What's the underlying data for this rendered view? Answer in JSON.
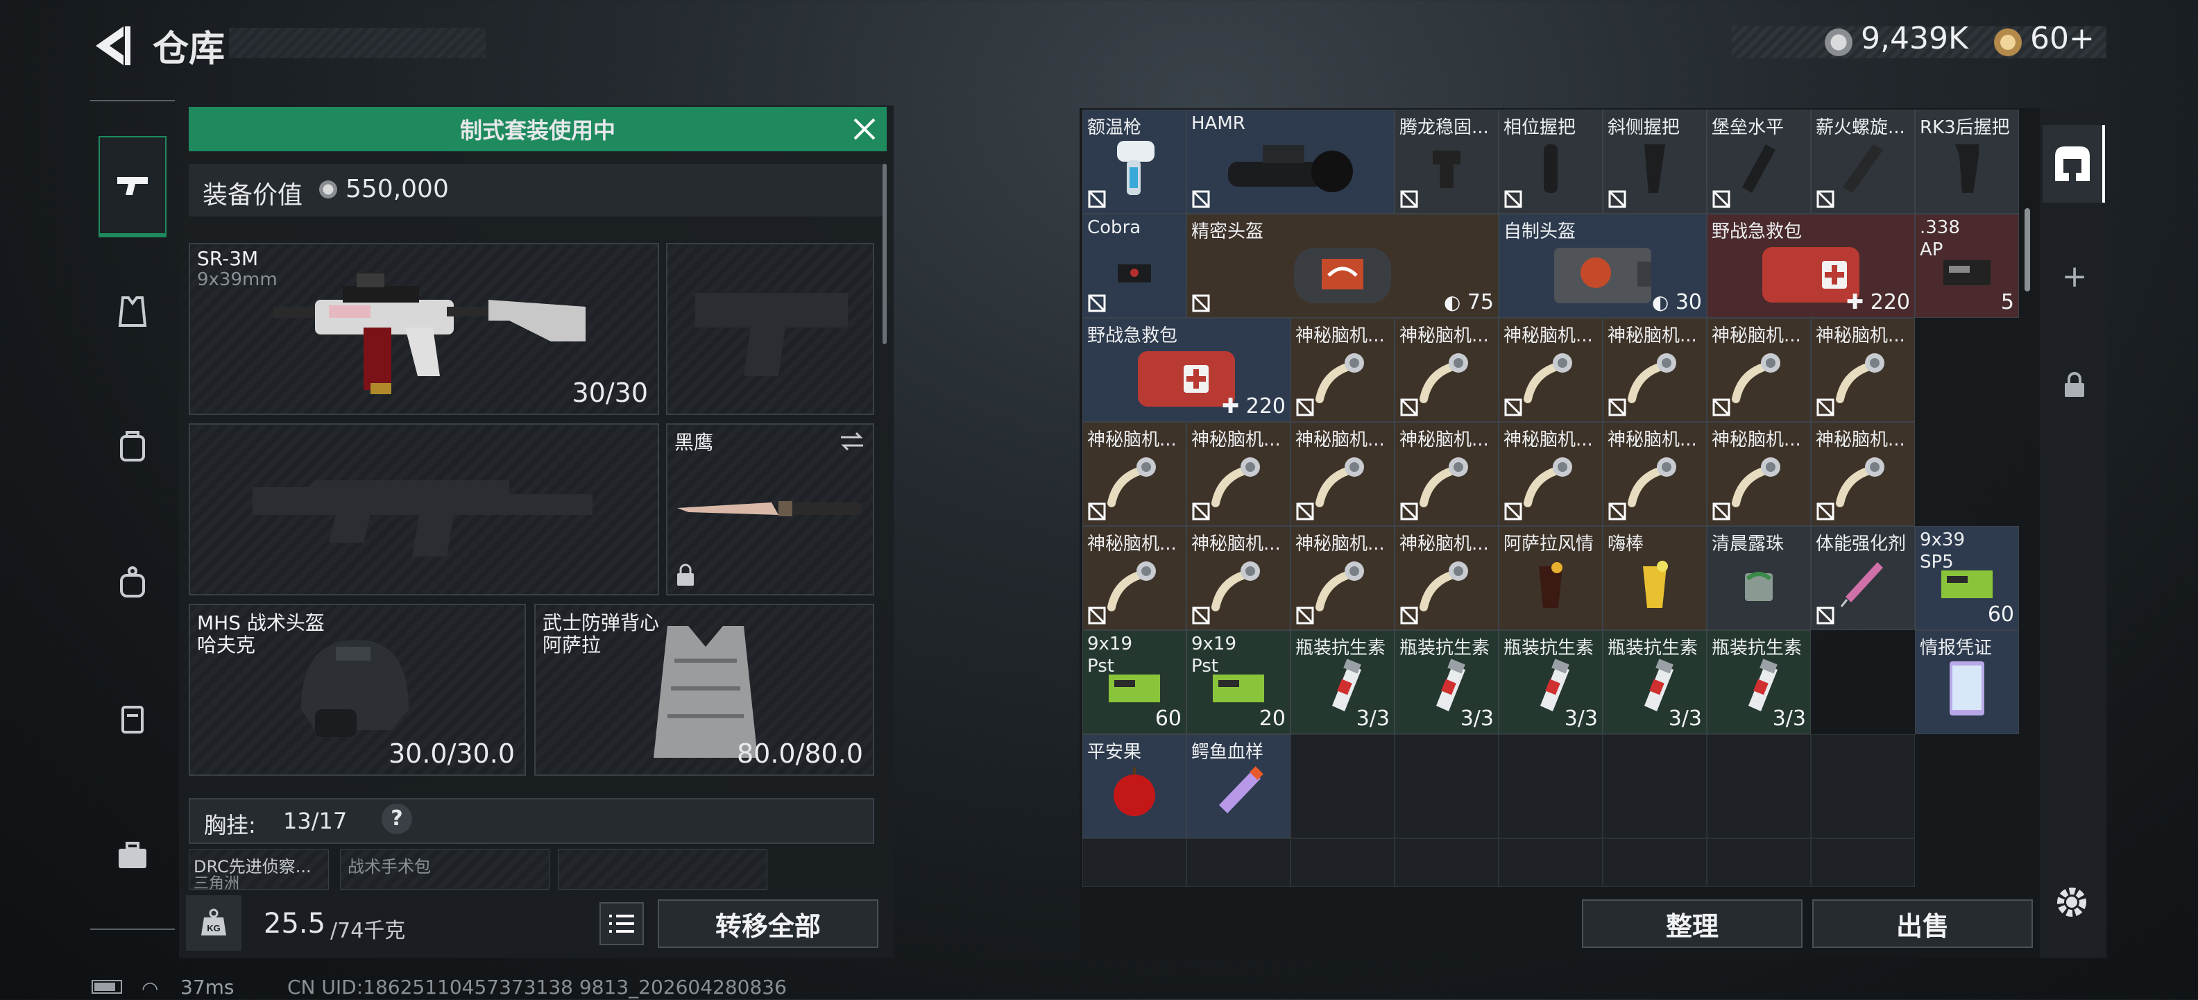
{
  "header": {
    "title": "仓库",
    "currency1": "9,439K",
    "currency2": "60+"
  },
  "banner": {
    "text": "制式套装使用中"
  },
  "equipment_value": {
    "label": "装备价值",
    "value": "550,000"
  },
  "slots": {
    "primary": {
      "name": "SR-3M",
      "caliber": "9x39mm",
      "ammo": "30/30"
    },
    "melee": {
      "name": "黑鹰"
    },
    "helmet": {
      "name": "MHS 战术头盔",
      "sub": "哈夫克",
      "durability": "30.0/30.0"
    },
    "armor": {
      "name": "武士防弹背心",
      "sub": "阿萨拉",
      "durability": "80.0/80.0"
    }
  },
  "chest_rig": {
    "label": "胸挂:",
    "value": "13/17",
    "help": "?"
  },
  "pouches": [
    "DRC先进侦察...",
    "战术手术包"
  ],
  "pouch_sub": "三角洲",
  "weight": {
    "value": "25.5",
    "max": "/74千克",
    "icon": "KG"
  },
  "buttons": {
    "transfer_all": "转移全部",
    "sort": "整理",
    "sell": "出售"
  },
  "inventory": [
    {
      "label": "额温枪"
    },
    {
      "label": "HAMR"
    },
    {
      "label": "腾龙稳固..."
    },
    {
      "label": "相位握把"
    },
    {
      "label": "斜侧握把"
    },
    {
      "label": "堡垒水平"
    },
    {
      "label": "薪火螺旋..."
    },
    {
      "label": "RK3后握把"
    },
    {
      "label": "Cobra"
    },
    {
      "label": "精密头盔",
      "count": "75"
    },
    {
      "label": "自制头盔",
      "count": "30"
    },
    {
      "label": "野战急救包",
      "count": "220"
    },
    {
      "label": ".338",
      "label2": "AP",
      "count": "5"
    },
    {
      "label": "野战急救包",
      "count": "220"
    },
    {
      "label": "神秘脑机..."
    },
    {
      "label": "阿萨拉风情"
    },
    {
      "label": "嗨棒"
    },
    {
      "label": "清晨露珠"
    },
    {
      "label": "体能强化剂"
    },
    {
      "label": "9x39",
      "label2": "SP5",
      "count": "60"
    },
    {
      "label": "9x19",
      "label2": "Pst",
      "count": "60"
    },
    {
      "label": "9x19",
      "label2": "Pst",
      "count": "20"
    },
    {
      "label": "瓶装抗生素",
      "count": "3/3"
    },
    {
      "label": "情报凭证"
    },
    {
      "label": "平安果"
    },
    {
      "label": "鳄鱼血样"
    }
  ],
  "footer": {
    "ping": "37ms",
    "uid": "CN UID:18625110457373138 9813_202604280836"
  },
  "colors": {
    "banner": "#1e8a5e",
    "rarity_blue": "#2e3b4e",
    "rarity_brown": "#3e3329",
    "rarity_green": "#25382f",
    "rarity_red": "#4a2a2c"
  }
}
